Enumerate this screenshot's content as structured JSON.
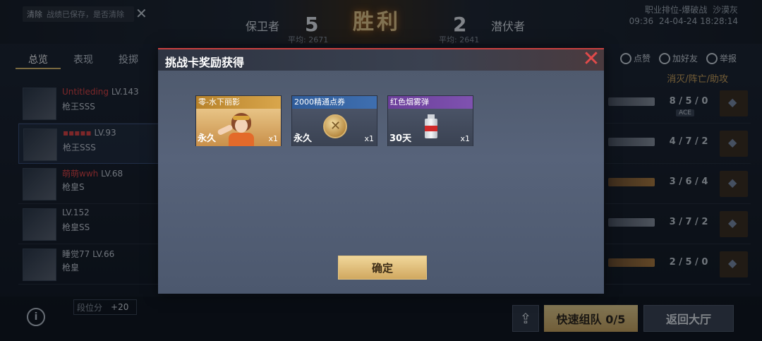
{
  "header": {
    "notice_clear": "清除",
    "notice_text": "战绩已保存，是否清除",
    "team_left": "保卫者",
    "score_left": "5",
    "avg_left": "平均: 2671",
    "result": "胜利",
    "score_right": "2",
    "team_right": "潜伏者",
    "avg_right": "平均: 2641",
    "mode": "职业排位-爆破战",
    "map": "沙漠灰",
    "time": "09:36",
    "date": "24-04-24 18:28:14"
  },
  "tabs": [
    "总览",
    "表现",
    "投掷"
  ],
  "actions": {
    "like": "点赞",
    "add_friend": "加好友",
    "report": "举报"
  },
  "stat_header": "消灭/阵亡/助攻",
  "players_left": [
    {
      "name": "Untitleding",
      "level": "LV.143",
      "rank": "枪王SSS"
    },
    {
      "name": "▪▪▪▪▪",
      "level": "LV.93",
      "rank": "枪王SSS"
    },
    {
      "name": "萌萌wwh",
      "level": "LV.68",
      "rank": "枪皇S"
    },
    {
      "name": "",
      "level": "LV.152",
      "rank": "枪皇SS"
    },
    {
      "name": "睡觉77",
      "level": "LV.66",
      "rank": "枪皇"
    }
  ],
  "players_right_stats": [
    {
      "kda": "8 / 5 / 0",
      "badge": "ACE"
    },
    {
      "kda": "4 / 7 / 2",
      "badge": ""
    },
    {
      "kda": "3 / 6 / 4",
      "badge": ""
    },
    {
      "kda": "3 / 7 / 2",
      "badge": ""
    },
    {
      "kda": "2 / 5 / 0",
      "badge": ""
    }
  ],
  "footer": {
    "points_label": "段位分",
    "points_value": "+20",
    "team_button": "快速组队 0/5",
    "lobby_button": "返回大厅"
  },
  "modal": {
    "title": "挑战卡奖励获得",
    "rewards": [
      {
        "name": "零-水下丽影",
        "duration": "永久",
        "count": "x1",
        "icon": "character-portrait-icon",
        "color": "#d9a64c"
      },
      {
        "name": "2000精通点券",
        "duration": "永久",
        "count": "x1",
        "icon": "coin-icon",
        "color": "#3f6fb0"
      },
      {
        "name": "红色烟雾弹",
        "duration": "30天",
        "count": "x1",
        "icon": "smoke-grenade-icon",
        "color": "#7f52b0"
      }
    ],
    "confirm": "确定"
  }
}
